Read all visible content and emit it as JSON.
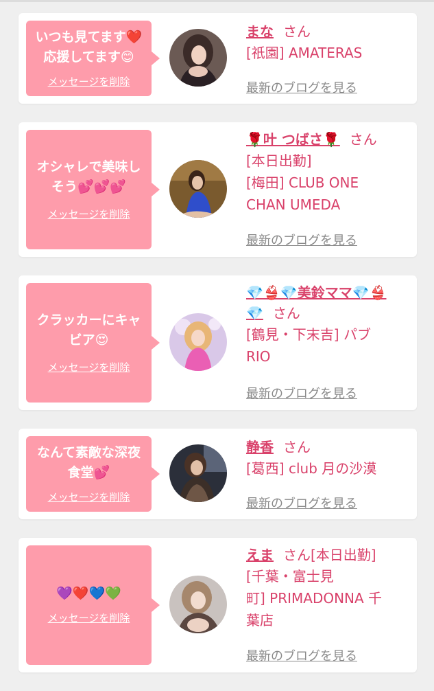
{
  "colors": {
    "background": "#efefef",
    "card": "#ffffff",
    "bubble": "#fe9cab",
    "accent_text": "#d9416a",
    "link_gray": "#8a8a8a"
  },
  "cards": [
    {
      "message_line1": "いつも見てます❤️",
      "message_line2": "応援してます😊",
      "delete_label": "メッセージを削除",
      "name": "まな",
      "honorific": "さん",
      "lines": [
        "[祇園] AMATERAS"
      ],
      "blog_label": "最新のブログを見る"
    },
    {
      "message_line1": "オシャレで美味し",
      "message_line2": "そう💕💕💕",
      "delete_label": "メッセージを削除",
      "name": "🌹叶 つばさ🌹",
      "honorific": "さん",
      "lines": [
        "[本日出勤]",
        "[梅田] CLUB ONE",
        "CHAN UMEDA"
      ],
      "blog_label": "最新のブログを見る"
    },
    {
      "message_line1": "クラッカーにキャ",
      "message_line2": "ビア😍",
      "delete_label": "メッセージを削除",
      "name": "💎👙💎美鈴ママ💎👙",
      "name_cont": "💎",
      "honorific": "さん",
      "lines": [
        "[鶴見・下末吉] パブ",
        "RIO"
      ],
      "blog_label": "最新のブログを見る"
    },
    {
      "message_line1": "なんて素敵な深夜",
      "message_line2": "食堂💕",
      "delete_label": "メッセージを削除",
      "name": "静香",
      "honorific": "さん",
      "lines": [
        "[葛西] club 月の沙漠"
      ],
      "blog_label": "最新のブログを見る"
    },
    {
      "message_line1": "💜❤️💙💚",
      "message_line2": "",
      "delete_label": "メッセージを削除",
      "name": "えま",
      "honorific": "さん[本日出勤]",
      "lines": [
        "[千葉・富士見",
        "町] PRIMADONNA 千",
        "葉店"
      ],
      "blog_label": "最新のブログを見る"
    }
  ]
}
